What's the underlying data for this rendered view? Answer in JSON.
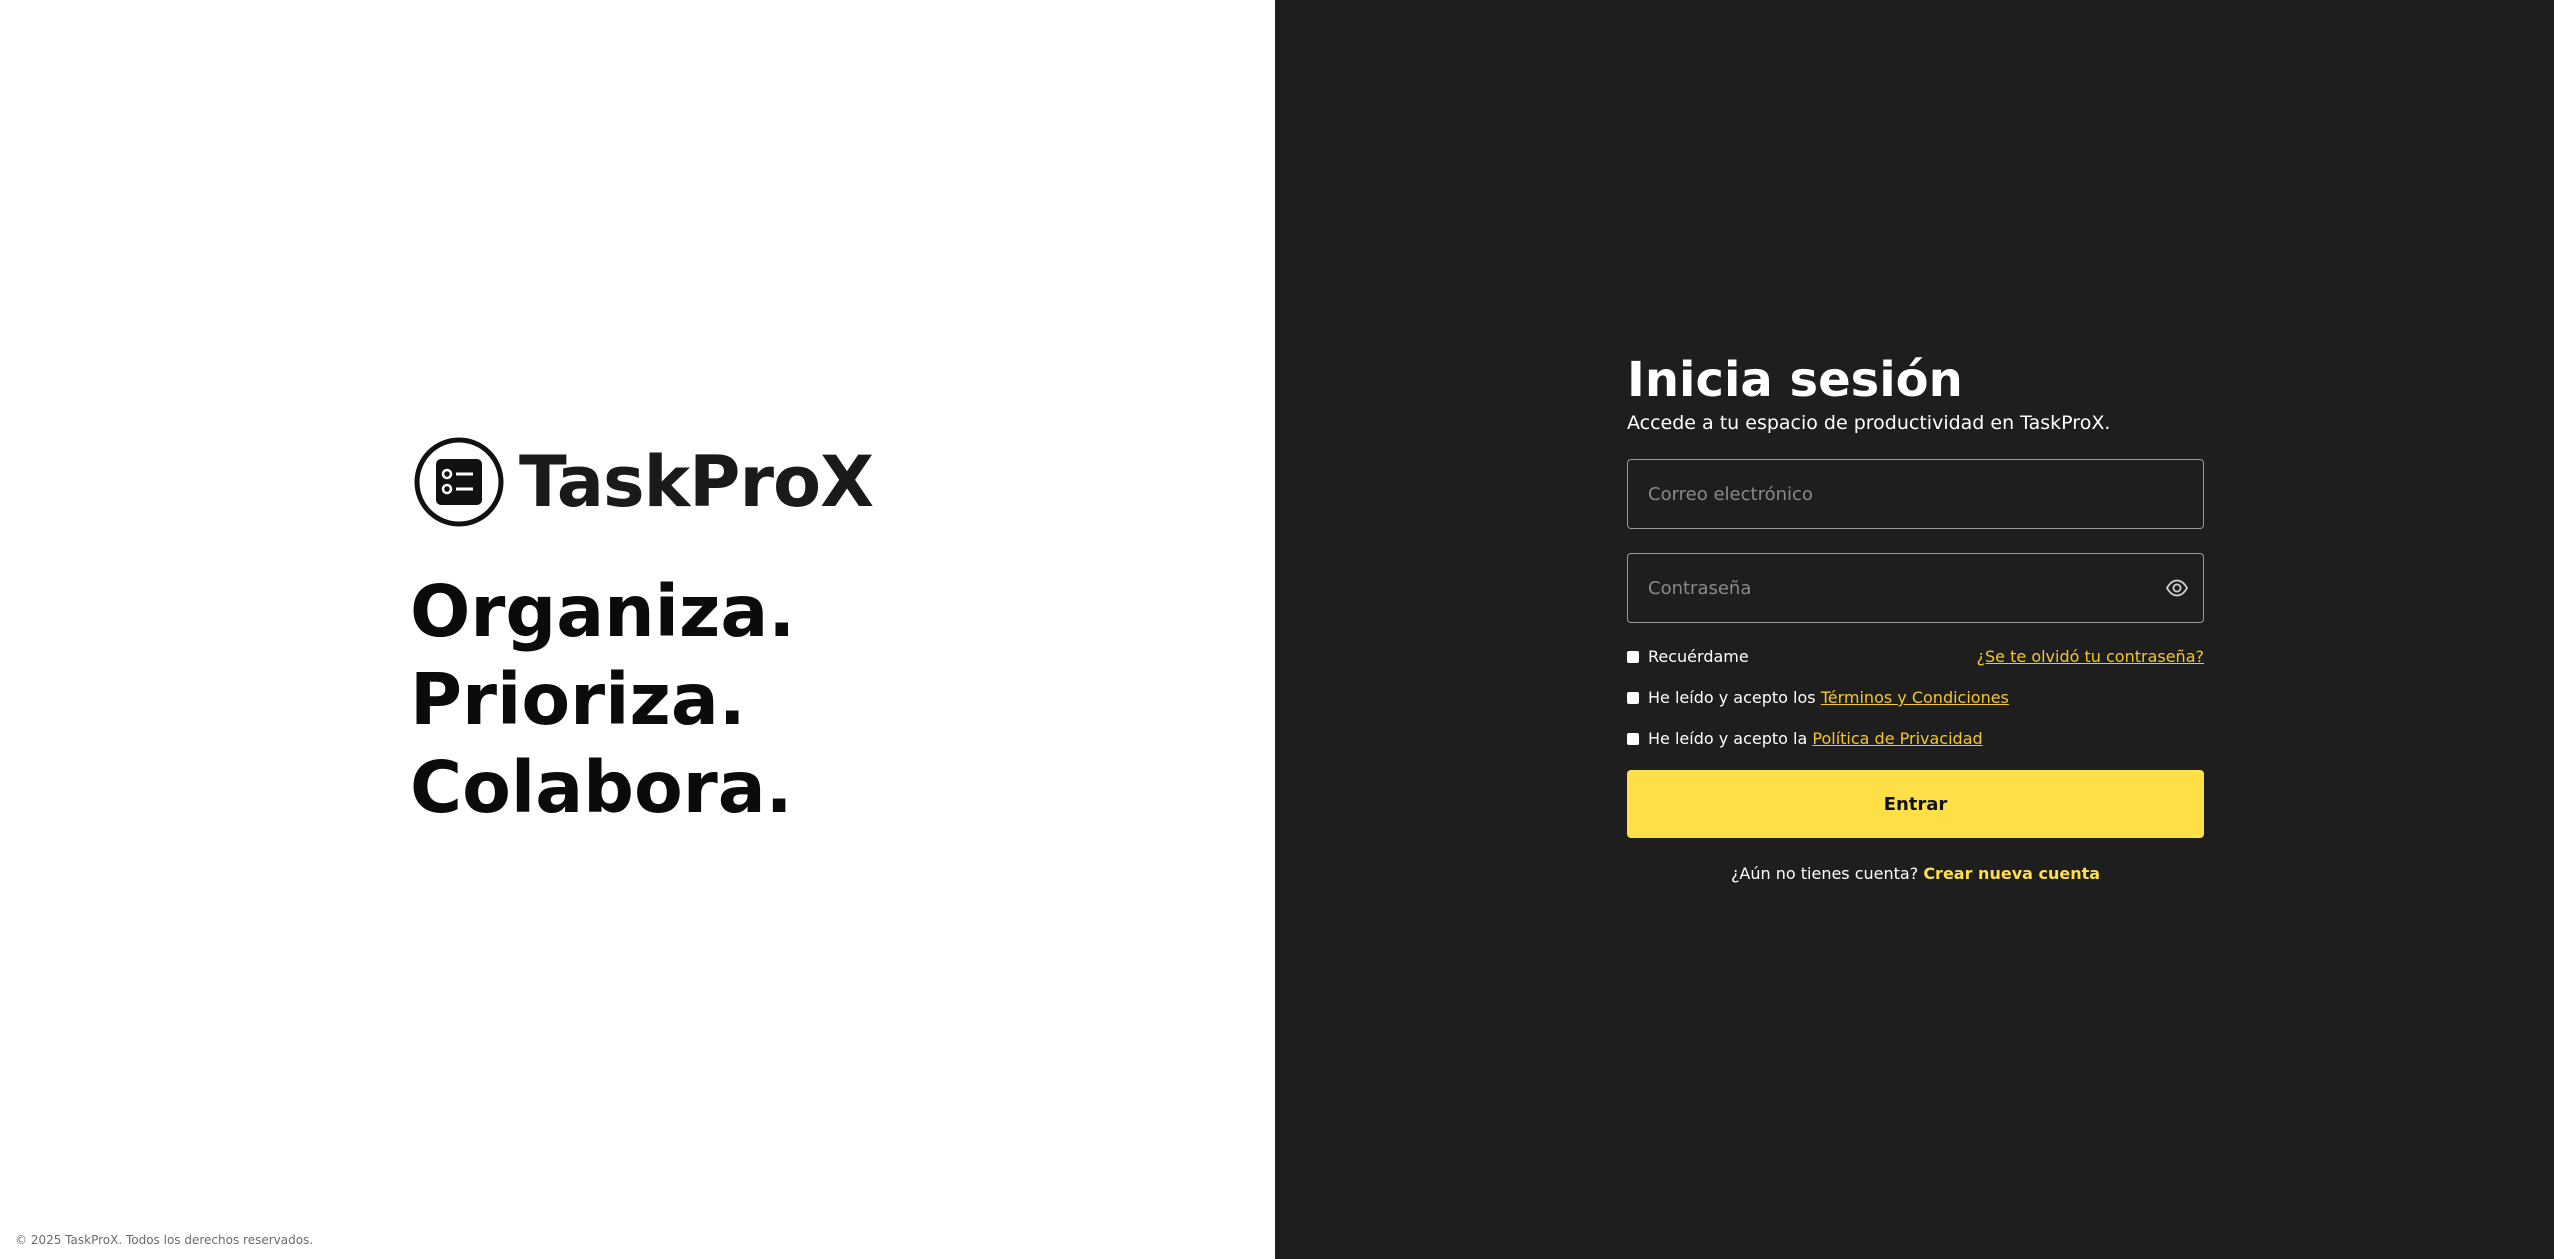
{
  "brand": {
    "name": "TaskProX",
    "slogans": [
      "Organiza.",
      "Prioriza.",
      "Colabora."
    ],
    "copyright": "© 2025 TaskProX. Todos los derechos reservados."
  },
  "login": {
    "title": "Inicia sesión",
    "subtitle": "Accede a tu espacio de productividad en TaskProX.",
    "email": {
      "placeholder": "Correo electrónico",
      "value": ""
    },
    "password": {
      "placeholder": "Contraseña",
      "value": ""
    },
    "remember_label": "Recuérdame",
    "forgot_link": "¿Se te olvidó tu contraseña?",
    "terms_prefix": "He leído y acepto los",
    "terms_link": "Términos y Condiciones",
    "privacy_prefix": "He leído y acepto la",
    "privacy_link": "Política de Privacidad",
    "submit_label": "Entrar",
    "signup_prompt": "¿Aún no tienes cuenta?",
    "signup_link": "Crear nueva cuenta"
  },
  "icons": {
    "logo": "checklist-circle-icon",
    "password_toggle": "eye-icon"
  },
  "colors": {
    "accent": "#fddf47",
    "link": "#f2c828",
    "panel_dark": "#1e1e1e",
    "panel_light": "#ffffff"
  }
}
